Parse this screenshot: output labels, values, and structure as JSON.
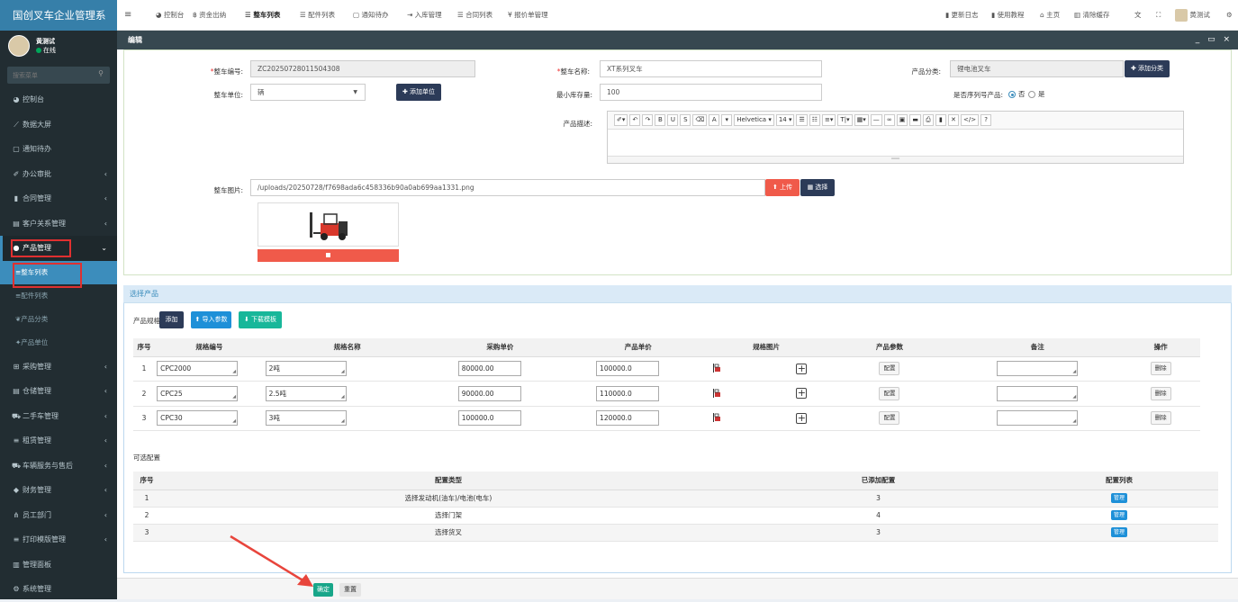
{
  "app": {
    "title": "国创叉车企业管理系"
  },
  "user": {
    "name": "黄测试",
    "status": "在线"
  },
  "sidebar": {
    "search_placeholder": "搜索菜单",
    "items": [
      {
        "label": "控制台",
        "icon": "dashboard-icon"
      },
      {
        "label": "数据大屏",
        "icon": "chart-icon"
      },
      {
        "label": "通知待办",
        "icon": "calendar-icon"
      },
      {
        "label": "办公审批",
        "icon": "wand-icon"
      },
      {
        "label": "合同管理",
        "icon": "bookmark-icon"
      },
      {
        "label": "客户关系管理",
        "icon": "id-card-icon"
      },
      {
        "label": "产品管理",
        "icon": "product-icon"
      },
      {
        "label": "整车列表",
        "icon": "list-icon"
      },
      {
        "label": "配件列表",
        "icon": "list-icon"
      },
      {
        "label": "产品分类",
        "icon": "leaf-icon"
      },
      {
        "label": "产品单位",
        "icon": "magic-icon"
      },
      {
        "label": "采购管理",
        "icon": "cart-icon"
      },
      {
        "label": "仓储管理",
        "icon": "database-icon"
      },
      {
        "label": "二手车管理",
        "icon": "car-icon"
      },
      {
        "label": "租赁管理",
        "icon": "list-icon"
      },
      {
        "label": "车辆服务与售后",
        "icon": "truck-icon"
      },
      {
        "label": "财务管理",
        "icon": "diamond-icon"
      },
      {
        "label": "员工部门",
        "icon": "sitemap-icon"
      },
      {
        "label": "打印模版管理",
        "icon": "list-icon"
      },
      {
        "label": "管理面板",
        "icon": "bar-chart-icon"
      },
      {
        "label": "系统管理",
        "icon": "cogs-icon"
      }
    ]
  },
  "topbar": {
    "menu_icon": "≡",
    "nav": [
      "控制台",
      "资金出纳",
      "整车列表",
      "配件列表",
      "通知待办",
      "入库管理",
      "合同列表",
      "报价单管理"
    ],
    "right": [
      "更新日志",
      "使用教程",
      "主页",
      "清除缓存",
      "黄测试"
    ]
  },
  "tab": {
    "title": "编辑"
  },
  "form": {
    "code_label": "整车编号:",
    "code_value": "ZC20250728011504308",
    "name_label": "整车名称:",
    "name_value": "XT系列叉车",
    "category_label": "产品分类:",
    "category_value": "锂电池叉车",
    "add_category": "添加分类",
    "unit_label": "整车单位:",
    "unit_value": "辆",
    "add_unit": "添加单位",
    "min_stock_label": "最小库存量:",
    "min_stock_value": "100",
    "serial_label": "是否序列号产品:",
    "serial_no": "否",
    "serial_yes": "是",
    "desc_label": "产品描述:",
    "image_label": "整车图片:",
    "image_path": "/uploads/20250728/f7698ada6c458336b90a0ab699aa1331.png",
    "upload_btn": "上传",
    "choose_btn": "选择"
  },
  "editor": {
    "font": "Helvetica",
    "size": "14",
    "buttons": [
      "✐▾",
      "↶",
      "↷",
      "B",
      "U",
      "S",
      "⌫",
      "A",
      "▾",
      "Helvetica ▾",
      "14 ▾",
      "☰",
      "☷",
      "≡▾",
      "T|▾",
      "▦▾",
      "—",
      "∞",
      "▣",
      "▬",
      "⎙",
      "▮",
      "✕",
      "</>",
      "?"
    ]
  },
  "products": {
    "section_title": "选择产品",
    "spec_label": "产品规格",
    "add_btn": "添加",
    "import_btn": "导入参数",
    "download_btn": "下载模板",
    "columns": [
      "序号",
      "规格编号",
      "规格名称",
      "采购单价",
      "产品单价",
      "规格图片",
      "产品参数",
      "备注",
      "操作"
    ],
    "rows": [
      {
        "no": "1",
        "code": "CPC2000",
        "name": "2吨",
        "cost": "80000.00",
        "price": "100000.0",
        "param": "配置",
        "note": "",
        "op": "删除"
      },
      {
        "no": "2",
        "code": "CPC25",
        "name": "2.5吨",
        "cost": "90000.00",
        "price": "110000.0",
        "param": "配置",
        "note": "",
        "op": "删除"
      },
      {
        "no": "3",
        "code": "CPC30",
        "name": "3吨",
        "cost": "100000.0",
        "price": "120000.0",
        "param": "配置",
        "note": "",
        "op": "删除"
      }
    ]
  },
  "options": {
    "title": "可选配置",
    "columns": [
      "序号",
      "配置类型",
      "已添加配置",
      "配置列表"
    ],
    "rows": [
      {
        "no": "1",
        "type": "选择发动机(油车)/电池(电车)",
        "count": "3",
        "btn": "管理"
      },
      {
        "no": "2",
        "type": "选择门架",
        "count": "4",
        "btn": "管理"
      },
      {
        "no": "3",
        "type": "选择货叉",
        "count": "3",
        "btn": "管理"
      }
    ]
  },
  "footer": {
    "confirm": "确定",
    "reset": "重置"
  },
  "colors": {
    "sidebar": "#222d32",
    "brand": "#367fa9",
    "accent": "#3c8dbc",
    "danger": "#f05a4a",
    "navy": "#2c3b58",
    "teal": "#18b79a"
  }
}
